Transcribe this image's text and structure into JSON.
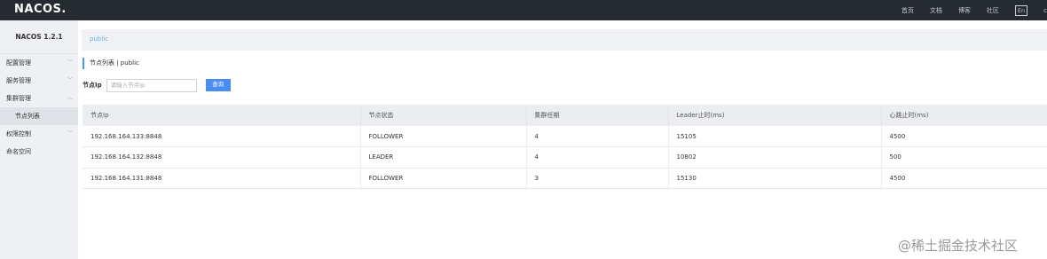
{
  "topbar": {
    "logo": "NACOS.",
    "nav": [
      "首页",
      "文档",
      "博客",
      "社区"
    ],
    "lang": "En",
    "cut_text": "c"
  },
  "sidebar": {
    "version": "NACOS 1.2.1",
    "items": [
      {
        "label": "配置管理",
        "chevron": "﹀"
      },
      {
        "label": "服务管理",
        "chevron": "﹀"
      },
      {
        "label": "集群管理",
        "chevron": "︿"
      },
      {
        "label": "节点列表",
        "sub": true
      },
      {
        "label": "权限控制",
        "chevron": "﹀"
      },
      {
        "label": "命名空间"
      }
    ]
  },
  "main": {
    "namespace": "public",
    "page_title": "节点列表 | public",
    "search": {
      "label": "节点Ip",
      "placeholder": "请输入节点Ip",
      "button": "查询"
    },
    "table": {
      "headers": [
        "节点Ip",
        "节点状态",
        "集群任期",
        "Leader止时(ms)",
        "心跳止时(ms)"
      ],
      "rows": [
        [
          "192.168.164.133:8848",
          "FOLLOWER",
          "4",
          "15105",
          "4500"
        ],
        [
          "192.168.164.132:8848",
          "LEADER",
          "4",
          "10802",
          "500"
        ],
        [
          "192.168.164.131:8848",
          "FOLLOWER",
          "3",
          "15130",
          "4500"
        ]
      ]
    }
  },
  "watermark": "@稀土掘金技术社区"
}
